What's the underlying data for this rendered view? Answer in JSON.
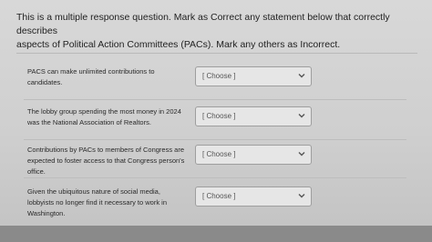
{
  "question": {
    "line1": "This is a multiple response question. Mark as Correct any statement below that correctly describes",
    "line2": "aspects of Political Action Committees (PACs). Mark any others as Incorrect."
  },
  "rows": [
    {
      "statement": "PACS can make unlimited contributions to candidates.",
      "select_value": "[ Choose ]"
    },
    {
      "statement": "The lobby group spending the most money in 2024 was the National Association of Realtors.",
      "select_value": "[ Choose ]"
    },
    {
      "statement": "Contributions by PACs to members of Congress are expected to foster access to that Congress person's office.",
      "select_value": "[ Choose ]"
    },
    {
      "statement": "Given the ubiquitous nature of social media, lobbyists no longer find it necessary to work in Washington.",
      "select_value": "[ Choose ]"
    }
  ],
  "icons": {
    "select_arrow": "chevron-down-icon"
  }
}
